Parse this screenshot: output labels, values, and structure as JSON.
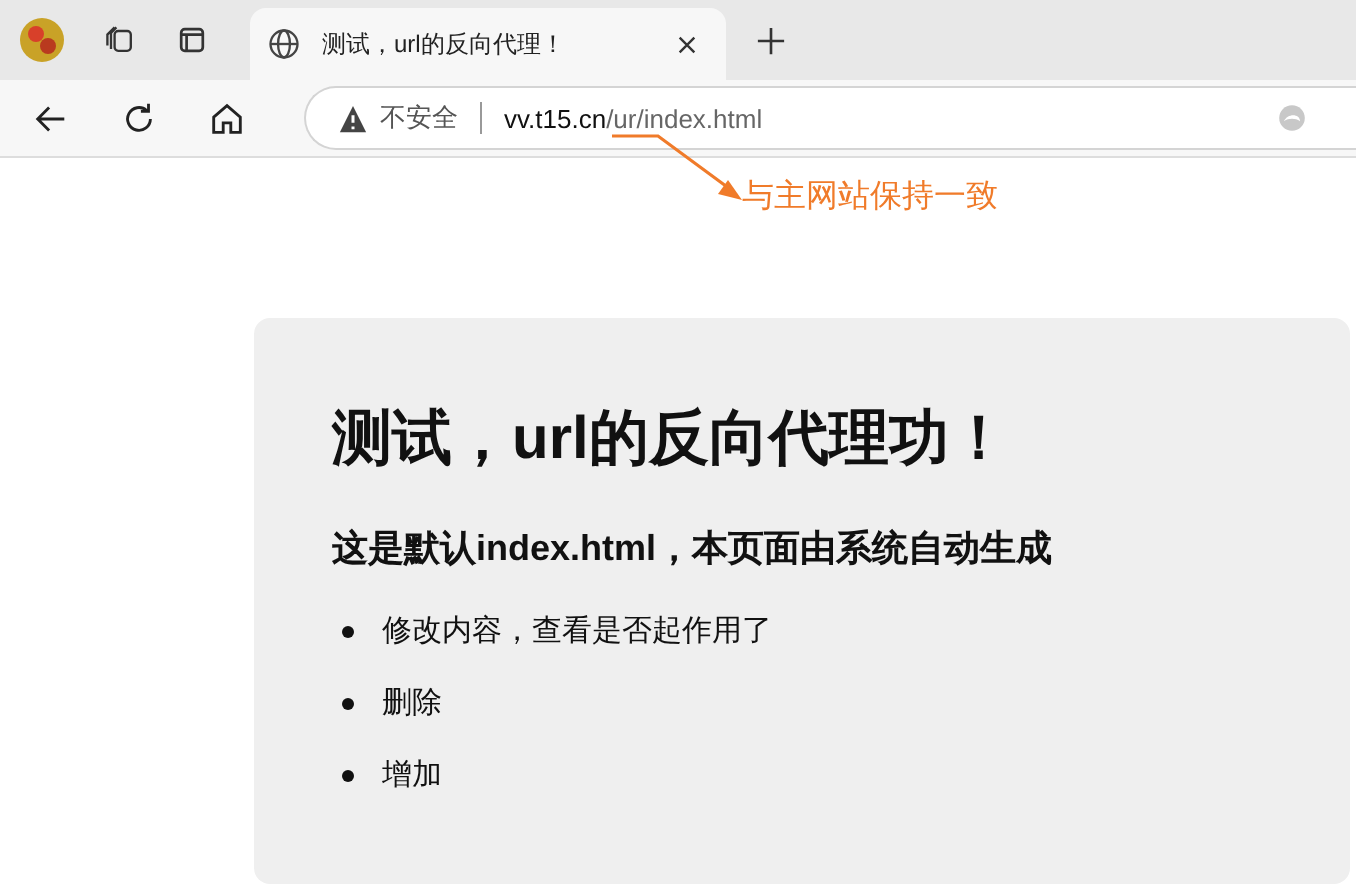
{
  "browser": {
    "tab": {
      "title": "测试，url的反向代理！",
      "selected": true
    },
    "address": {
      "security": "不安全",
      "url_host": "vv.t15.cn",
      "url_path": "/ur/index.html"
    }
  },
  "annotation": {
    "text": "与主网站保持一致"
  },
  "page": {
    "heading": "测试，url的反向代理功！",
    "subheading": "这是默认index.html，本页面由系统自动生成",
    "items": [
      "修改内容，查看是否起作用了",
      "删除",
      "增加"
    ]
  }
}
